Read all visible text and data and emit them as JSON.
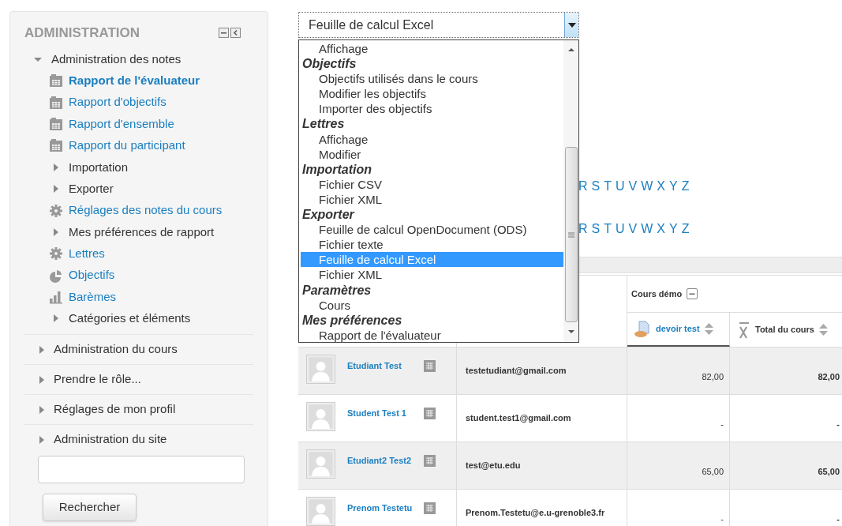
{
  "admin_block": {
    "title": "ADMINISTRATION",
    "tree": [
      {
        "label": "Administration des notes",
        "expanded": true,
        "children": [
          {
            "label": "Rapport de l'évaluateur",
            "kind": "report",
            "selected": true
          },
          {
            "label": "Rapport d'objectifs",
            "kind": "report",
            "selected": false
          },
          {
            "label": "Rapport d'ensemble",
            "kind": "report",
            "selected": false
          },
          {
            "label": "Rapport du participant",
            "kind": "report",
            "selected": false
          },
          {
            "label": "Importation",
            "kind": "folder",
            "expanded": false
          },
          {
            "label": "Exporter",
            "kind": "folder",
            "expanded": false
          },
          {
            "label": "Réglages des notes du cours",
            "kind": "settings",
            "selected": false
          },
          {
            "label": "Mes préférences de rapport",
            "kind": "folder",
            "expanded": false
          },
          {
            "label": "Lettres",
            "kind": "settings",
            "selected": false
          },
          {
            "label": "Objectifs",
            "kind": "objectives",
            "selected": false
          },
          {
            "label": "Barèmes",
            "kind": "scales",
            "selected": false
          },
          {
            "label": "Catégories et éléments",
            "kind": "folder",
            "expanded": false
          }
        ]
      },
      {
        "label": "Administration du cours",
        "expanded": false
      },
      {
        "label": "Prendre le rôle...",
        "expanded": false
      },
      {
        "label": "Réglages de mon profil",
        "expanded": false
      },
      {
        "label": "Administration du site",
        "expanded": false
      }
    ],
    "search_button": "Rechercher"
  },
  "export_select": {
    "value": "Feuille de calcul Excel",
    "options": [
      {
        "kind": "option",
        "label": "Affichage",
        "selected": false
      },
      {
        "kind": "group",
        "label": "Objectifs"
      },
      {
        "kind": "option",
        "label": "Objectifs utilisés dans le cours",
        "selected": false
      },
      {
        "kind": "option",
        "label": "Modifier les objectifs",
        "selected": false
      },
      {
        "kind": "option",
        "label": "Importer des objectifs",
        "selected": false
      },
      {
        "kind": "group",
        "label": "Lettres"
      },
      {
        "kind": "option",
        "label": "Affichage",
        "selected": false
      },
      {
        "kind": "option",
        "label": "Modifier",
        "selected": false
      },
      {
        "kind": "group",
        "label": "Importation"
      },
      {
        "kind": "option",
        "label": "Fichier CSV",
        "selected": false
      },
      {
        "kind": "option",
        "label": "Fichier XML",
        "selected": false
      },
      {
        "kind": "group",
        "label": "Exporter"
      },
      {
        "kind": "option",
        "label": "Feuille de calcul OpenDocument (ODS)",
        "selected": false
      },
      {
        "kind": "option",
        "label": "Fichier texte",
        "selected": false
      },
      {
        "kind": "option",
        "label": "Feuille de calcul Excel",
        "selected": true
      },
      {
        "kind": "option",
        "label": "Fichier XML",
        "selected": false
      },
      {
        "kind": "group",
        "label": "Paramètres"
      },
      {
        "kind": "option",
        "label": "Cours",
        "selected": false
      },
      {
        "kind": "group",
        "label": "Mes préférences"
      },
      {
        "kind": "option",
        "label": "Rapport de l'évaluateur",
        "selected": false
      }
    ]
  },
  "letter_rows": [
    [
      "R",
      "S",
      "T",
      "U",
      "V",
      "W",
      "X",
      "Y",
      "Z"
    ],
    [
      "R",
      "S",
      "T",
      "U",
      "V",
      "W",
      "X",
      "Y",
      "Z"
    ]
  ],
  "grade_table": {
    "category": "Cours démo",
    "columns": [
      {
        "label": "devoir test",
        "kind": "assignment"
      },
      {
        "label": "Total du cours",
        "kind": "total"
      }
    ],
    "rows": [
      {
        "name": "Etudiant Test",
        "email": "testetudiant@gmail.com",
        "grade": "82,00",
        "total": "82,00"
      },
      {
        "name": "Student Test 1",
        "email": "student.test1@gmail.com",
        "grade": "-",
        "total": "-"
      },
      {
        "name": "Etudiant2 Test2",
        "email": "test@etu.edu",
        "grade": "65,00",
        "total": "65,00"
      },
      {
        "name": "Prenom Testetu",
        "email": "Prenom.Testetu@e.u-grenoble3.fr",
        "grade": "-",
        "total": "-"
      }
    ]
  }
}
